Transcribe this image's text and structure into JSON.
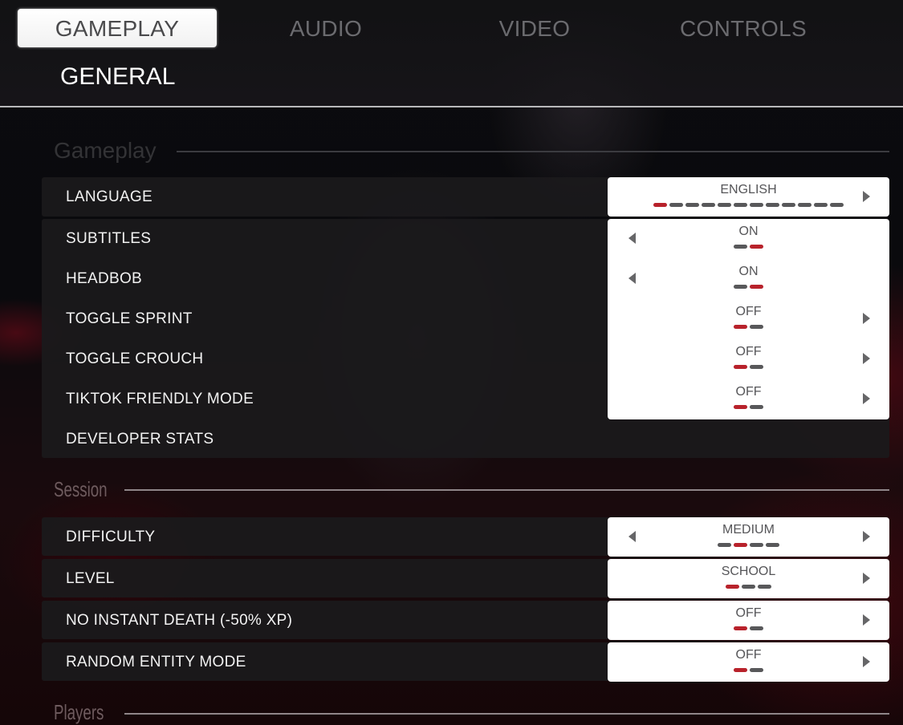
{
  "tabs": [
    {
      "label": "GAMEPLAY",
      "active": true
    },
    {
      "label": "AUDIO",
      "active": false
    },
    {
      "label": "VIDEO",
      "active": false
    },
    {
      "label": "CONTROLS",
      "active": false
    }
  ],
  "subtab": "GENERAL",
  "colors": {
    "accent_red": "#b8222b",
    "segment_inactive": "#58585a",
    "value_box_bg": "#ffffff",
    "row_bg": "#1b1a1c"
  },
  "sections": [
    {
      "title": "Gameplay",
      "settings": [
        {
          "label": "LANGUAGE",
          "value": "ENGLISH",
          "options_count": 12,
          "selected_index": 0,
          "left_arrow": false,
          "right_arrow": true
        },
        {
          "label": "SUBTITLES",
          "value": "ON",
          "options_count": 2,
          "selected_index": 1,
          "left_arrow": true,
          "right_arrow": false
        },
        {
          "label": "HEADBOB",
          "value": "ON",
          "options_count": 2,
          "selected_index": 1,
          "left_arrow": true,
          "right_arrow": false
        },
        {
          "label": "TOGGLE SPRINT",
          "value": "OFF",
          "options_count": 2,
          "selected_index": 0,
          "left_arrow": false,
          "right_arrow": true
        },
        {
          "label": "TOGGLE CROUCH",
          "value": "OFF",
          "options_count": 2,
          "selected_index": 0,
          "left_arrow": false,
          "right_arrow": true
        },
        {
          "label": "TIKTOK FRIENDLY MODE",
          "value": "OFF",
          "options_count": 2,
          "selected_index": 0,
          "left_arrow": false,
          "right_arrow": true
        },
        {
          "label": "DEVELOPER STATS"
        }
      ]
    },
    {
      "title": "Session",
      "settings": [
        {
          "label": "DIFFICULTY",
          "value": "MEDIUM",
          "options_count": 4,
          "selected_index": 1,
          "left_arrow": true,
          "right_arrow": true
        },
        {
          "label": "LEVEL",
          "value": "SCHOOL",
          "options_count": 3,
          "selected_index": 0,
          "left_arrow": false,
          "right_arrow": true
        },
        {
          "label": "NO INSTANT DEATH (-50% XP)",
          "value": "OFF",
          "options_count": 2,
          "selected_index": 0,
          "left_arrow": false,
          "right_arrow": true
        },
        {
          "label": "RANDOM ENTITY MODE",
          "value": "OFF",
          "options_count": 2,
          "selected_index": 0,
          "left_arrow": false,
          "right_arrow": true
        }
      ]
    },
    {
      "title": "Players",
      "settings": []
    }
  ]
}
